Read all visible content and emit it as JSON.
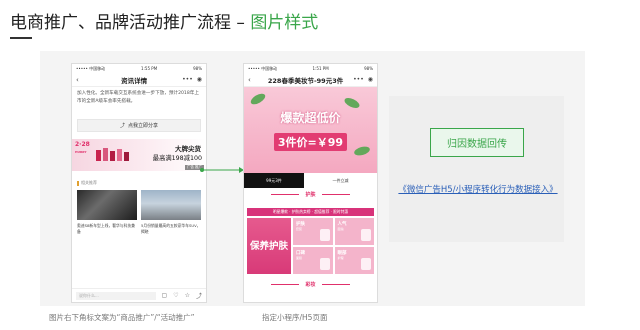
{
  "slide": {
    "title_main": "电商推广、品牌活动推广流程 – ",
    "title_highlight": "图片样式",
    "accent_color": "#3aa64a"
  },
  "phone1": {
    "status_left": "••••• 中国移动",
    "status_time": "1:55 PM",
    "status_right": "98%",
    "nav_title": "资讯详情",
    "article_text": "加入性化。全新车载交互系统会进一步下放，预计2018年上市的全新A级车会率先搭载。",
    "share_label": "点我立即分享",
    "share_icon": "share-icon",
    "promo_date": "2·28",
    "promo_date_sub": "HURRY",
    "promo_title": "大牌尖货",
    "promo_subtitle": "最高满198减100",
    "promo_tag": "广告 推广",
    "related_title": "相关推荐",
    "cards": [
      {
        "text": "奥迪S8新车型上线，奢华与科技兼备"
      },
      {
        "text": "5月份销量最高的五款豪华车SUV，揭晓"
      }
    ],
    "comment_placeholder": "说你什么...",
    "bottom_icons": [
      "comment-icon",
      "like-icon",
      "star-icon",
      "share-icon"
    ]
  },
  "phone2": {
    "status_left": "••••• 中国移动",
    "status_time": "1:51 PM",
    "status_right": "98%",
    "nav_title": "228春季美妆节-99元3件",
    "hero_title": "爆款超低价",
    "hero_price": "3件价=￥99",
    "bar_left": "99元3件",
    "bar_right": "一件立减",
    "section1": "护肤",
    "pink_banner": "明星爆款 · 护肤热卖榜 · 超值推荐 · 限时特惠",
    "grid_big": "保养护肤",
    "grid": [
      {
        "title": "护肤",
        "sub": "套装"
      },
      {
        "title": "人气",
        "sub": "面霜"
      },
      {
        "title": "口碑",
        "sub": "面膜"
      },
      {
        "title": "眼部",
        "sub": "护理"
      }
    ],
    "section2": "彩妆"
  },
  "right": {
    "attr_button": "归因数据回传",
    "link_text": "《微信广告H5/小程序转化行为数据接入》"
  },
  "captions": {
    "left": "图片右下角标文案为“商品推广”/“活动推广”",
    "right": "指定小程序/H5页面"
  }
}
